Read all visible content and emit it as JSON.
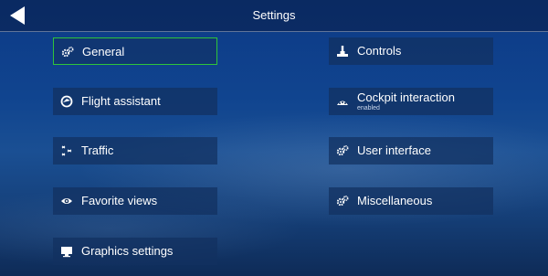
{
  "header": {
    "title": "Settings",
    "back_icon": "back-arrow-icon"
  },
  "menu": {
    "left": [
      {
        "label": "General",
        "icon": "gears-icon",
        "selected": true
      },
      {
        "label": "Flight assistant",
        "icon": "flight-assistant-icon"
      },
      {
        "label": "Traffic",
        "icon": "traffic-icon"
      },
      {
        "label": "Favorite views",
        "icon": "eye-icon"
      },
      {
        "label": "Graphics settings",
        "icon": "monitor-icon"
      }
    ],
    "right": [
      {
        "label": "Controls",
        "icon": "joystick-icon"
      },
      {
        "label": "Cockpit interaction",
        "sublabel": "enabled",
        "icon": "cockpit-interaction-icon"
      },
      {
        "label": "User interface",
        "icon": "gears-icon"
      },
      {
        "label": "Miscellaneous",
        "icon": "gears-icon"
      }
    ]
  },
  "colors": {
    "selection_border": "#2fc43a",
    "text": "#ffffff"
  }
}
